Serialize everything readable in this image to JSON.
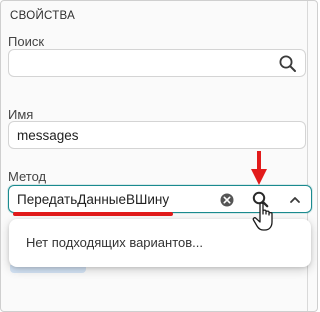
{
  "panel": {
    "title": "СВОЙСТВА"
  },
  "search": {
    "label": "Поиск",
    "value": ""
  },
  "name": {
    "label": "Имя",
    "value": "messages"
  },
  "method": {
    "label": "Метод",
    "value": "ПередатьДанныеВШину"
  },
  "dropdown": {
    "message": "Нет подходящих вариантов..."
  },
  "icons": {
    "search": "search-icon",
    "clear": "clear-circle-icon",
    "method_search": "search-icon",
    "collapse": "chevron-up-icon",
    "annotation_arrow": "red-down-arrow",
    "cursor": "hand-pointer-cursor"
  },
  "colors": {
    "focus_border": "#1a8a8f",
    "annotation": "#e21b1b"
  }
}
